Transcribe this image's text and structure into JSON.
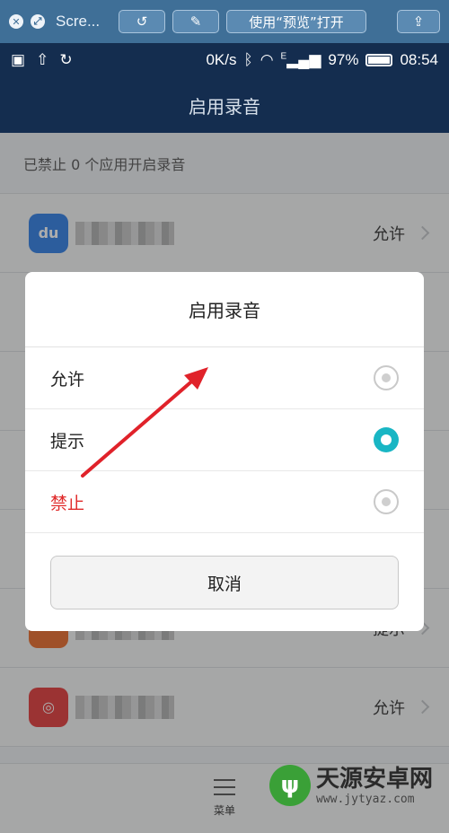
{
  "ql": {
    "title": "Scre...",
    "open_with": "使用“预览”打开"
  },
  "status": {
    "speed": "0K/s",
    "network": "E",
    "battery": "97%",
    "time": "08:54",
    "battery_level": 0.97
  },
  "header": {
    "title": "启用录音"
  },
  "list": {
    "summary": "已禁止 0 个应用开启录音",
    "rows": [
      {
        "icon": "du",
        "icon_color": "#2f7ee6",
        "permission": "允许"
      },
      {
        "icon": "",
        "icon_color": "#e86b2a",
        "permission": "提示"
      },
      {
        "icon": "",
        "icon_color": "#e23b3b",
        "permission": "允许"
      }
    ]
  },
  "bottom_nav": {
    "menu_label": "菜单"
  },
  "dialog": {
    "title": "启用录音",
    "options": [
      {
        "label": "允许",
        "selected": false
      },
      {
        "label": "提示",
        "selected": true
      },
      {
        "label": "禁止",
        "selected": false
      }
    ],
    "cancel_label": "取消"
  },
  "watermark": {
    "name": "天源安卓网",
    "url": "www.jytyaz.com"
  },
  "colors": {
    "header_bg": "#142d4f",
    "accent_radio": "#19b6c4",
    "danger_text": "#e02b2b",
    "arrow": "#e0222a"
  }
}
